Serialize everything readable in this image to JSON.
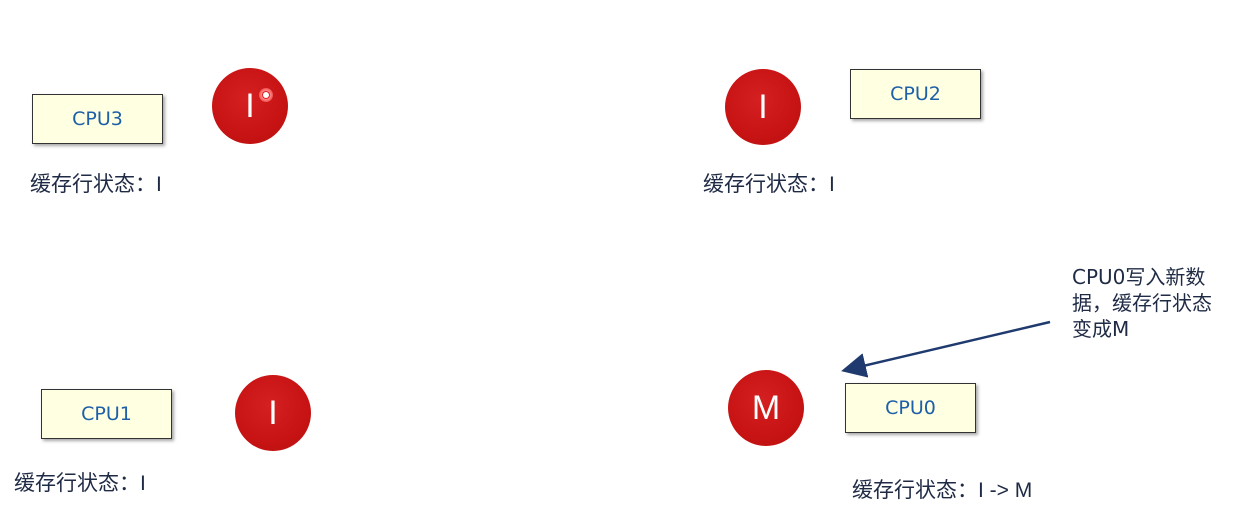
{
  "nodes": [
    {
      "id": "cpu3",
      "label": "CPU3",
      "state": "I",
      "status_label": "缓存行状态：",
      "status_value": "I"
    },
    {
      "id": "cpu2",
      "label": "CPU2",
      "state": "I",
      "status_label": "缓存行状态：",
      "status_value": "I"
    },
    {
      "id": "cpu1",
      "label": "CPU1",
      "state": "I",
      "status_label": "缓存行状态：",
      "status_value": "I"
    },
    {
      "id": "cpu0",
      "label": "CPU0",
      "state": "M",
      "status_label": "缓存行状态：",
      "status_value": "I -> M"
    }
  ],
  "annotation": {
    "lines": [
      "CPU0写入新数",
      "据，缓存行状态",
      "变成M"
    ]
  },
  "colors": {
    "box_fill": "#ffffe2",
    "box_text": "#1d5fa8",
    "state_circle": "#c71313",
    "arrow": "#1f3a6e",
    "text": "#1f2a44"
  }
}
